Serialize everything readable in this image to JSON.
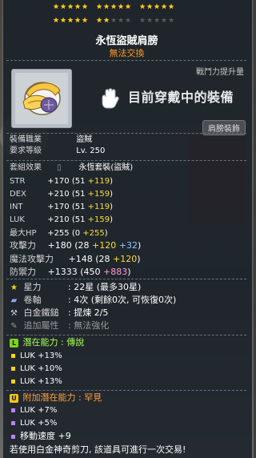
{
  "stars": {
    "row1": [
      "★",
      "★",
      "★",
      "★",
      "★",
      "★",
      "★",
      "★",
      "★",
      "★",
      "★",
      "★",
      "★",
      "★",
      "★"
    ],
    "row2_on": [
      "★",
      "★",
      "★",
      "★",
      "★",
      "★",
      "★"
    ],
    "row2_off": [
      "★",
      "★",
      "★",
      "★",
      "★",
      "★",
      "★",
      "★"
    ]
  },
  "item": {
    "name": "永恆盜賊肩膀",
    "trade": "無法交換",
    "power_label": "戰鬥力提升量",
    "equipped_text": "目前穿戴中的裝備",
    "slot_badge": "肩膀裝飾"
  },
  "req": {
    "job_label": "裝備職業",
    "job_value": "盜賊",
    "level_label": "要求等級",
    "level_value": "Lv. 250"
  },
  "set": {
    "label": "套組效果",
    "value": "永恆套裝(盜賊)"
  },
  "stats": [
    {
      "name": "STR",
      "base": "+170",
      "detail_open": "(51",
      "bonus": "+119",
      "detail_close": ")",
      "bonus_color": "yellow"
    },
    {
      "name": "DEX",
      "base": "+210",
      "detail_open": "(51",
      "bonus": "+159",
      "detail_close": ")",
      "bonus_color": "yellow"
    },
    {
      "name": "INT",
      "base": "+170",
      "detail_open": "(51",
      "bonus": "+119",
      "detail_close": ")",
      "bonus_color": "yellow"
    },
    {
      "name": "LUK",
      "base": "+210",
      "detail_open": "(51",
      "bonus": "+159",
      "detail_close": ")",
      "bonus_color": "yellow"
    },
    {
      "name": "最大HP",
      "base": "+255",
      "detail_open": "(0",
      "bonus": "+255",
      "detail_close": ")",
      "bonus_color": "yellow"
    }
  ],
  "attack": {
    "name": "攻擊力",
    "base": "+180",
    "p1": "(28",
    "b1": "+120",
    "b2": "+32",
    "close": ")"
  },
  "magic": {
    "name": "魔法攻擊力",
    "base": "+148",
    "p1": "(28",
    "b1": "+120",
    "close": ")"
  },
  "defense": {
    "name": "防禦力",
    "base": "+1333",
    "p1": "(450",
    "b1": "+883",
    "close": ")"
  },
  "enhance": {
    "star_label": "星力",
    "star_value": ": 22星 (最多30星)",
    "scroll_label": "卷軸",
    "scroll_value": ": 4次 (剩餘0次, 可恢復0次)",
    "hammer_label": "白金鐵鎚",
    "hammer_value": ": 提煉 2/5",
    "extra_label": "追加屬性",
    "extra_value": ": 無法強化"
  },
  "potential": {
    "icon": "L",
    "label": "潛在能力",
    "sep": " : ",
    "grade": "傳說",
    "lines": [
      "LUK +13%",
      "LUK +10%",
      "LUK +13%"
    ]
  },
  "bonus_potential": {
    "icon": "U",
    "label": "附加潛在能力",
    "sep": " : ",
    "grade": "罕見",
    "lines": [
      "LUK +7%",
      "LUK +5%",
      "移動速度 +9"
    ]
  },
  "footer": "若使用白金神奇剪刀, 該道具可進行一次交易!",
  "colors": {
    "star": "#ffd21a",
    "bonus": "#ffdc3a",
    "blue_bonus": "#8fc7ff",
    "pink_bonus": "#ff9bd6",
    "orange": "#ffa040",
    "legend_green": "#7ed321"
  }
}
